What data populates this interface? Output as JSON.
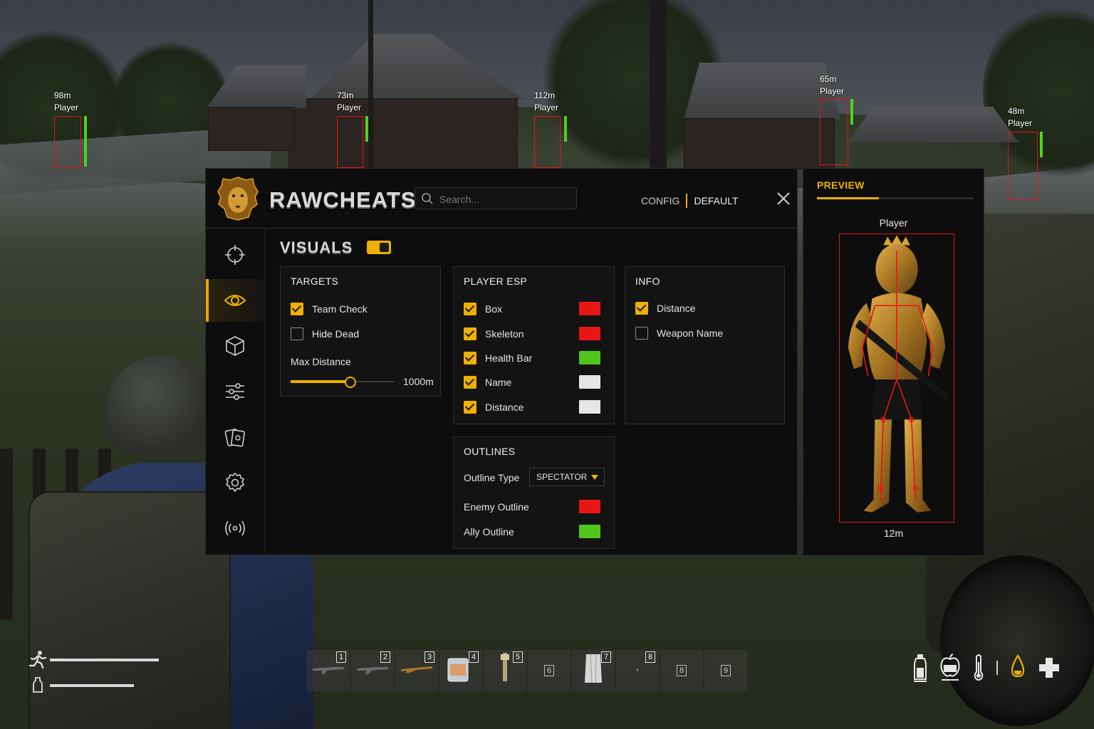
{
  "esp_targets": [
    {
      "distance": "98m",
      "label": "Player",
      "health": 1.0
    },
    {
      "distance": "73m",
      "label": "Player",
      "health": 1.0
    },
    {
      "distance": "112m",
      "label": "Player",
      "health": 1.0
    },
    {
      "distance": "65m",
      "label": "Player",
      "health": 1.0
    },
    {
      "distance": "48m",
      "label": "Player",
      "health": 1.0
    }
  ],
  "header": {
    "brand": "RAWCHEATS",
    "search_placeholder": "Search...",
    "config_label": "CONFIG",
    "config_value": "DEFAULT"
  },
  "sidebar": {
    "items": [
      {
        "icon": "crosshair-icon",
        "active": false
      },
      {
        "icon": "eye-icon",
        "active": true
      },
      {
        "icon": "cube-icon",
        "active": false
      },
      {
        "icon": "sliders-icon",
        "active": false
      },
      {
        "icon": "cards-icon",
        "active": false
      },
      {
        "icon": "gear-icon",
        "active": false
      },
      {
        "icon": "broadcast-icon",
        "active": false
      }
    ]
  },
  "section": {
    "title": "VISUALS",
    "enabled": true
  },
  "targets": {
    "title": "TARGETS",
    "team_check": {
      "label": "Team Check",
      "checked": true
    },
    "hide_dead": {
      "label": "Hide Dead",
      "checked": false
    },
    "max_distance_label": "Max Distance",
    "max_distance_value": "1000m",
    "max_distance_fraction": 0.57
  },
  "player_esp": {
    "title": "PLAYER ESP",
    "items": [
      {
        "label": "Box",
        "checked": true,
        "color": "#e81515"
      },
      {
        "label": "Skeleton",
        "checked": true,
        "color": "#e81515"
      },
      {
        "label": "Health Bar",
        "checked": true,
        "color": "#52c51c"
      },
      {
        "label": "Name",
        "checked": true,
        "color": "#e6e6e6"
      },
      {
        "label": "Distance",
        "checked": true,
        "color": "#e6e6e6"
      }
    ]
  },
  "info": {
    "title": "INFO",
    "items": [
      {
        "label": "Distance",
        "checked": true
      },
      {
        "label": "Weapon Name",
        "checked": false
      }
    ]
  },
  "outlines": {
    "title": "OUTLINES",
    "type_label": "Outline Type",
    "type_value": "SPECTATOR",
    "enemy_label": "Enemy Outline",
    "enemy_color": "#e81515",
    "ally_label": "Ally Outline",
    "ally_color": "#52c51c"
  },
  "preview": {
    "title": "PREVIEW",
    "name": "Player",
    "distance": "12m"
  },
  "hud": {
    "stamina": 0.85,
    "water_level": 0.62,
    "hotbar": [
      {
        "num": "1",
        "item": "rifle-icon",
        "filled": true
      },
      {
        "num": "2",
        "item": "rifle-icon",
        "filled": true
      },
      {
        "num": "3",
        "item": "shotgun-icon",
        "filled": true
      },
      {
        "num": "4",
        "item": "canister-icon",
        "filled": true
      },
      {
        "num": "5",
        "item": "bandage-icon",
        "filled": true
      },
      {
        "num": "6",
        "filled": false
      },
      {
        "num": "7",
        "item": "cloth-icon",
        "filled": true
      },
      {
        "num": "8",
        "item": "small-item-icon",
        "filled": true
      },
      {
        "num": "8",
        "filled": false
      },
      {
        "num": "9",
        "filled": false
      }
    ],
    "status_icons": [
      "water-bottle-icon",
      "food-icon",
      "thermometer-icon",
      "blood-drop-icon",
      "health-cross-icon"
    ]
  }
}
